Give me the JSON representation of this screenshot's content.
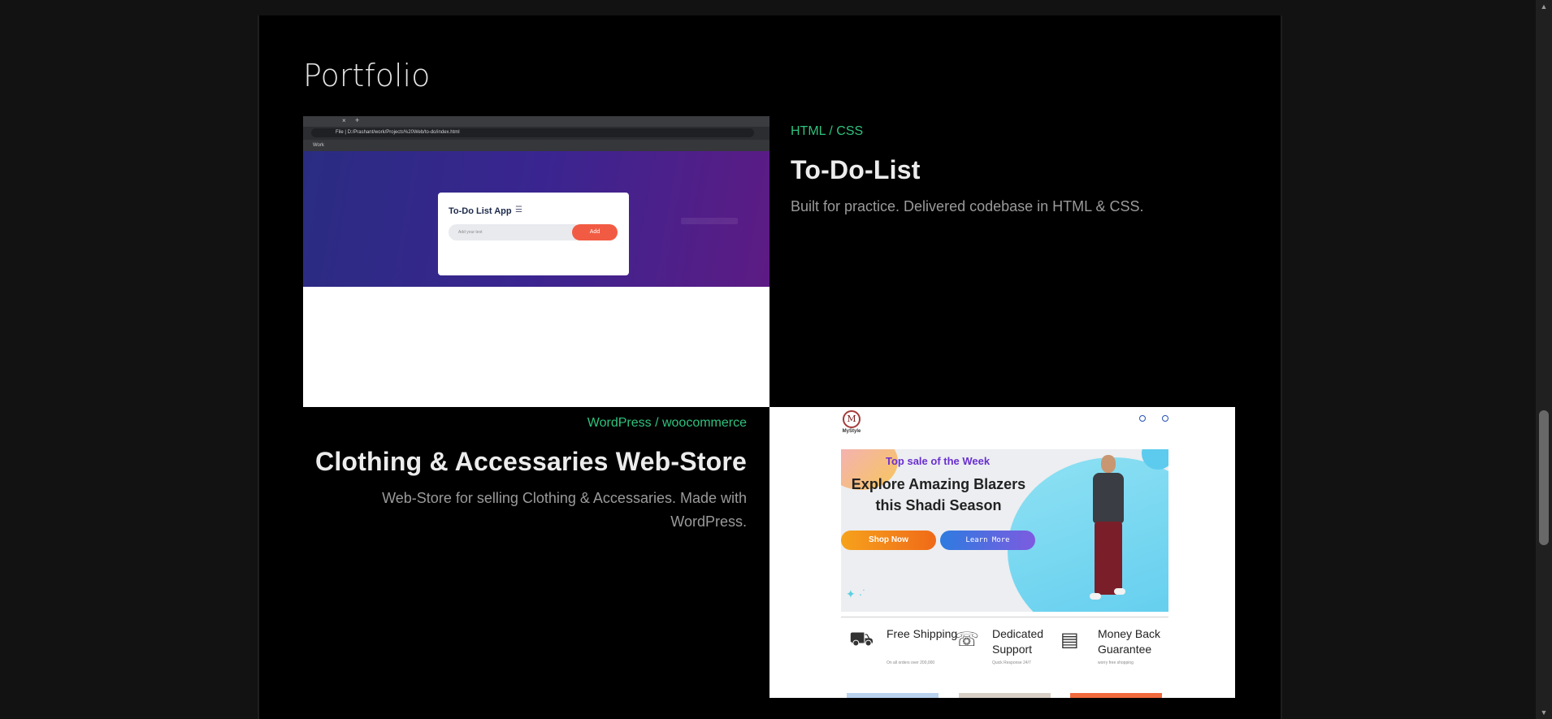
{
  "section": {
    "title": "Portfolio"
  },
  "projects": [
    {
      "tag": "HTML / CSS",
      "title": "To-Do-List",
      "description": "Built for practice. Delivered codebase in HTML & CSS.",
      "screenshot": {
        "tab_close": "×",
        "tab_add": "+",
        "url": "D:/Prashant/work/Projects%20Web/to-do/index.html",
        "url_prefix": "File",
        "bookmark": "Work",
        "app_title": "To-Do List App",
        "menu_icon": "☰",
        "input_placeholder": "Add your text",
        "add_label": "Add"
      }
    },
    {
      "tag": "WordPress / woocommerce",
      "title": "Clothing & Accessaries Web-Store",
      "description": "Web-Store for selling Clothing & Accessaries. Made with WordPress.",
      "screenshot": {
        "logo_letter": "M",
        "logo_name": "MyStyle",
        "banner_kicker": "Top sale of the Week",
        "banner_heading": "Explore Amazing Blazers this Shadi Season",
        "shop_button": "Shop Now",
        "learn_button": "Learn More",
        "features": [
          {
            "icon": "truck-icon",
            "glyph": "⛟",
            "title": "Free Shipping",
            "subtitle": "On all orders over 200,000"
          },
          {
            "icon": "headset-icon",
            "glyph": "☏",
            "title": "Dedicated Support",
            "subtitle": "Quick Response 24/7"
          },
          {
            "icon": "money-icon",
            "glyph": "▤",
            "title": "Money Back Guarantee",
            "subtitle": "worry free shopping"
          }
        ]
      }
    }
  ],
  "scrollbar": {
    "up_arrow": "▲",
    "down_arrow": "▼"
  }
}
